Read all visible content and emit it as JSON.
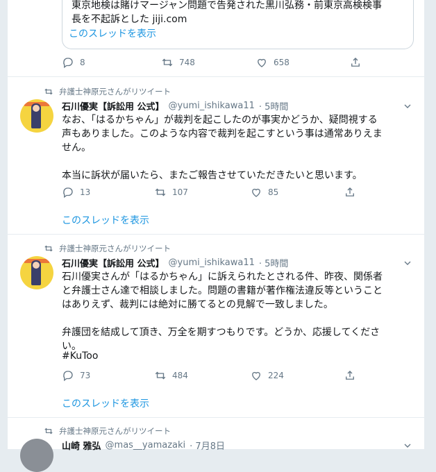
{
  "top_tweet": {
    "card_line1": "東京地検は賭けマージャン問題で告発された黒川弘務・前東京高検検事",
    "card_line2": "長を不起訴とした jiji.com",
    "show_thread": "このスレッドを表示",
    "reply_count": "8",
    "retweet_count": "748",
    "like_count": "658"
  },
  "tweets": [
    {
      "retweeted_by": "弁護士神原元さんがリツイート",
      "name": "石川優実【訴訟用 公式】",
      "handle": "@yumi_ishikawa11",
      "time": "· 5時間",
      "text": "なお、「はるかちゃん」が裁判を起こしたのが事実かどうか、疑問視する\n声もありました。このような内容で裁判を起こすという事は通常ありえま\nせん。\n\n本当に訴状が届いたら、またご報告させていただきたいと思います。",
      "reply_count": "13",
      "retweet_count": "107",
      "like_count": "85",
      "show_thread": "このスレッドを表示"
    },
    {
      "retweeted_by": "弁護士神原元さんがリツイート",
      "name": "石川優実【訴訟用 公式】",
      "handle": "@yumi_ishikawa11",
      "time": "· 5時間",
      "text": "石川優実さんが「はるかちゃん」に訴えられたとされる件、昨夜、関係者\nと弁護士さん達で相談しました。問題の書籍が著作権法違反等ということ\nはありえず、裁判には絶対に勝てるとの見解で一致しました。\n\n弁護団を結成して頂き、万全を期すつもりです。どうか、応援してくださ\nい。",
      "hashtag": "#KuToo",
      "reply_count": "73",
      "retweet_count": "484",
      "like_count": "224",
      "show_thread": "このスレッドを表示"
    },
    {
      "retweeted_by": "弁護士神原元さんがリツイート",
      "name": "山崎 雅弘",
      "handle": "@mas__yamazaki",
      "time": "· 7月8日"
    }
  ],
  "icons": [
    "reply-icon",
    "retweet-icon",
    "like-icon",
    "share-icon",
    "chevron-down-icon"
  ]
}
